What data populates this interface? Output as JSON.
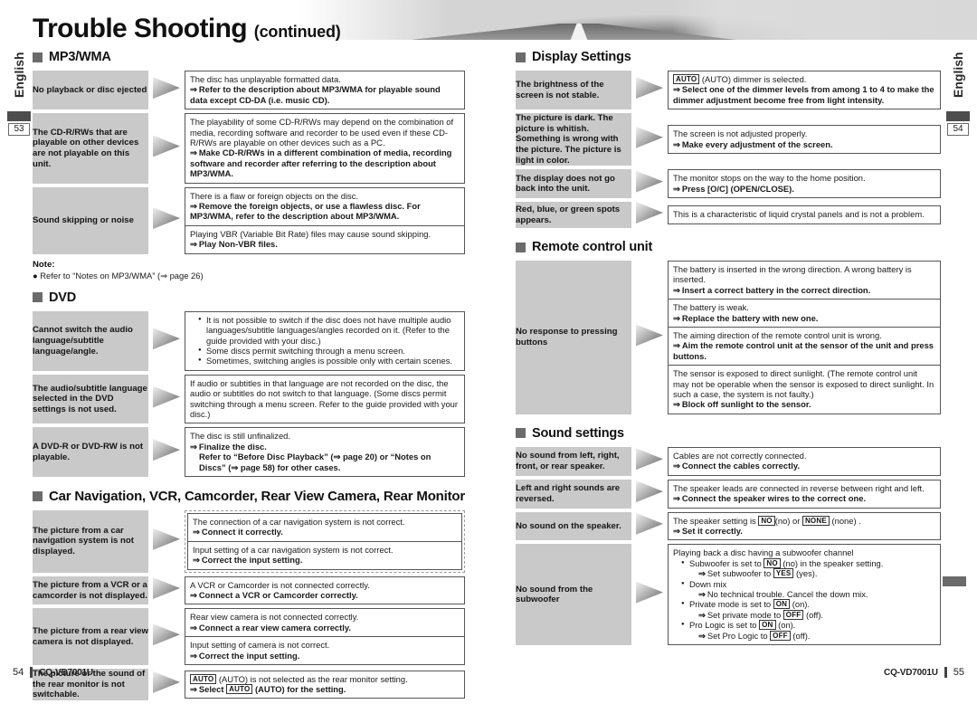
{
  "header": {
    "title": "Trouble Shooting",
    "title_suffix": "(continued)"
  },
  "side_tabs": {
    "left": {
      "language": "English",
      "page": "53"
    },
    "right": {
      "language": "English",
      "page": "54"
    }
  },
  "footer": {
    "left_page": "54",
    "left_model": "CQ-VD7001U",
    "right_model": "CQ-VD7001U",
    "right_page": "55"
  },
  "sections": {
    "mp3wma": {
      "heading": "MP3/WMA",
      "rows": [
        {
          "symptom": "No playback or disc ejected",
          "blocks": [
            {
              "lines": [
                {
                  "text": "The disc has unplayable formatted data.",
                  "bold": false
                },
                {
                  "text": "Refer to the description about MP3/WMA for playable sound data except CD-DA (i.e. music CD).",
                  "bold": true,
                  "arrow": true
                }
              ]
            }
          ]
        },
        {
          "symptom": "The CD-R/RWs that are playable on other devices are not playable on this unit.",
          "blocks": [
            {
              "lines": [
                {
                  "text": "The playability of some CD-R/RWs may depend on the combination of media, recording software and recorder to be used even if these CD-R/RWs are playable on other devices such as a PC.",
                  "bold": false
                },
                {
                  "text": "Make CD-R/RWs in a different combination of media, recording software and recorder after referring to the description about MP3/WMA.",
                  "bold": true,
                  "arrow": true
                }
              ]
            }
          ]
        },
        {
          "symptom": "Sound skipping or noise",
          "blocks": [
            {
              "lines": [
                {
                  "text": "There is a flaw or foreign objects on the disc.",
                  "bold": false
                },
                {
                  "text": "Remove the foreign objects, or use a flawless disc. For MP3/WMA, refer to the description about MP3/WMA.",
                  "bold": true,
                  "arrow": true
                }
              ]
            },
            {
              "lines": [
                {
                  "text": "Playing VBR (Variable Bit Rate) files may cause sound skipping.",
                  "bold": false
                },
                {
                  "text": "Play Non-VBR files.",
                  "bold": true,
                  "arrow": true
                }
              ]
            }
          ]
        }
      ],
      "note_label": "Note:",
      "note_text": "Refer to “Notes on MP3/WMA” (⇒ page 26)"
    },
    "dvd": {
      "heading": "DVD",
      "rows": [
        {
          "symptom": "Cannot switch the audio language/subtitle language/angle.",
          "bullets": [
            "It is not possible to switch if the disc does not have multiple audio languages/subtitle languages/angles recorded on it. (Refer to the guide provided with your disc.)",
            "Some discs permit switching through a menu screen.",
            "Sometimes, switching angles is possible only with certain scenes."
          ]
        },
        {
          "symptom": "The audio/subtitle language selected in the DVD settings is not used.",
          "blocks": [
            {
              "lines": [
                {
                  "text": "If audio or subtitles in that language are not recorded on the disc, the audio or subtitles do not switch to that language. (Some discs permit switching through a menu screen. Refer to the guide provided with your disc.)",
                  "bold": false
                }
              ]
            }
          ]
        },
        {
          "symptom": "A DVD-R or DVD-RW is not playable.",
          "blocks": [
            {
              "lines": [
                {
                  "text": "The disc is still unfinalized.",
                  "bold": false
                },
                {
                  "text": "Finalize the disc.",
                  "bold": true,
                  "arrow": true
                },
                {
                  "text": "Refer to “Before Disc Playback” (⇒ page 20) or “Notes on Discs” (⇒ page 58) for other cases.",
                  "bold": true,
                  "indent": true
                }
              ]
            }
          ]
        }
      ]
    },
    "car_nav": {
      "heading": "Car Navigation, VCR, Camcorder, Rear View Camera, Rear Monitor",
      "rows": [
        {
          "symptom": "The picture from a car navigation system is not displayed.",
          "dashed": true,
          "blocks": [
            {
              "lines": [
                {
                  "text": "The connection of a car navigation system is not correct.",
                  "bold": false
                },
                {
                  "text": "Connect it correctly.",
                  "bold": true,
                  "arrow": true
                }
              ]
            },
            {
              "lines": [
                {
                  "text": "Input setting of a car navigation system is not correct.",
                  "bold": false
                },
                {
                  "text": "Correct the input setting.",
                  "bold": true,
                  "arrow": true
                }
              ]
            }
          ]
        },
        {
          "symptom": "The picture from a VCR or a camcorder is not displayed.",
          "blocks": [
            {
              "lines": [
                {
                  "text": "A VCR or Camcorder is not connected correctly.",
                  "bold": false
                },
                {
                  "text": "Connect a VCR or Camcorder correctly.",
                  "bold": true,
                  "arrow": true
                }
              ]
            }
          ]
        },
        {
          "symptom": "The picture from a rear view camera is not displayed.",
          "blocks": [
            {
              "lines": [
                {
                  "text": "Rear view camera is not connected correctly.",
                  "bold": false
                },
                {
                  "text": "Connect a rear view camera correctly.",
                  "bold": true,
                  "arrow": true
                }
              ]
            },
            {
              "lines": [
                {
                  "text": "Input setting of camera is not correct.",
                  "bold": false
                },
                {
                  "text": "Correct the input setting.",
                  "bold": true,
                  "arrow": true
                }
              ]
            }
          ]
        },
        {
          "symptom": "The picture or the sound of the rear monitor is not switchable.",
          "blocks": [
            {
              "rich": true,
              "line1_kbd": "AUTO",
              "line1_rest": "(AUTO) is not selected as the rear monitor setting.",
              "line2_pre": "Select",
              "line2_kbd": "AUTO",
              "line2_rest": "(AUTO) for the setting."
            }
          ]
        }
      ]
    },
    "display_settings": {
      "heading": "Display Settings",
      "rows": [
        {
          "symptom": "The brightness of the screen is not stable.",
          "blocks": [
            {
              "rich": true,
              "line1_kbd": "AUTO",
              "line1_rest": "(AUTO) dimmer is selected.",
              "line2_bold_full": "Select one of the dimmer levels from among 1 to 4 to make the dimmer adjustment become free from light intensity."
            }
          ]
        },
        {
          "symptom": "The picture is dark. The picture is whitish. Something is wrong with the picture. The picture is light in color.",
          "blocks": [
            {
              "lines": [
                {
                  "text": "The screen is not adjusted properly.",
                  "bold": false
                },
                {
                  "text": "Make every adjustment of the screen.",
                  "bold": true,
                  "arrow": true
                }
              ]
            }
          ]
        },
        {
          "symptom": "The display does not go back into the unit.",
          "blocks": [
            {
              "lines": [
                {
                  "text": "The monitor stops on the way to the home position.",
                  "bold": false
                },
                {
                  "text": "Press [O/C] (OPEN/CLOSE).",
                  "bold": true,
                  "arrow": true
                }
              ]
            }
          ]
        },
        {
          "symptom": "Red, blue, or green spots appears.",
          "blocks": [
            {
              "lines": [
                {
                  "text": "This is a characteristic of liquid crystal panels and is not a problem.",
                  "bold": false
                }
              ]
            }
          ]
        }
      ]
    },
    "remote_control": {
      "heading": "Remote control unit",
      "rows": [
        {
          "symptom": "No response to pressing buttons",
          "blocks": [
            {
              "lines": [
                {
                  "text": "The battery is inserted in the wrong direction. A wrong battery is inserted.",
                  "bold": false
                },
                {
                  "text": "Insert a correct battery in the correct direction.",
                  "bold": true,
                  "arrow": true
                }
              ]
            },
            {
              "lines": [
                {
                  "text": "The battery is weak.",
                  "bold": false
                },
                {
                  "text": "Replace the battery with new one.",
                  "bold": true,
                  "arrow": true
                }
              ]
            },
            {
              "lines": [
                {
                  "text": "The aiming direction of the remote control unit is wrong.",
                  "bold": false
                },
                {
                  "text": "Aim the remote control unit at the sensor of the unit and press buttons.",
                  "bold": true,
                  "arrow": true
                }
              ]
            },
            {
              "lines": [
                {
                  "text": "The sensor is exposed to direct sunlight. (The remote control unit may not be operable when the sensor is exposed to direct sunlight. In such a case, the system is not faulty.)",
                  "bold": false
                },
                {
                  "text": "Block off sunlight to the sensor.",
                  "bold": true,
                  "arrow": true
                }
              ]
            }
          ]
        }
      ]
    },
    "sound_settings": {
      "heading": "Sound settings",
      "rows": [
        {
          "symptom": "No sound from left, right, front, or rear speaker.",
          "blocks": [
            {
              "lines": [
                {
                  "text": "Cables are not correctly connected.",
                  "bold": false
                },
                {
                  "text": "Connect the cables correctly.",
                  "bold": true,
                  "arrow": true
                }
              ]
            }
          ]
        },
        {
          "symptom": "Left and right sounds are reversed.",
          "blocks": [
            {
              "lines": [
                {
                  "text": "The speaker leads are connected in reverse between right and left.",
                  "bold": false
                },
                {
                  "text": "Connect the speaker wires to the correct one.",
                  "bold": true,
                  "arrow": true
                }
              ]
            }
          ]
        },
        {
          "symptom": "No sound on the speaker.",
          "speaker_setting": {
            "pre": "The speaker setting is",
            "kbd1": "NO",
            "mid1": "(no) or",
            "kbd2": "NONE",
            "post": "(none) .",
            "action": "Set it correctly."
          }
        },
        {
          "symptom": "No sound from the subwoofer",
          "subwoofer": {
            "intro": "Playing back a disc having a subwoofer channel",
            "items": [
              {
                "pre": "Subwoofer is set to",
                "kbd": "NO",
                "post": "(no) in the speaker setting.",
                "act_pre": "Set subwoofer to",
                "act_kbd": "YES",
                "act_post": "(yes)."
              },
              {
                "pre": "Down mix",
                "kbd": "",
                "post": "",
                "act_pre": "No technical trouble. Cancel the down mix.",
                "act_kbd": "",
                "act_post": ""
              },
              {
                "pre": "Private mode is set to",
                "kbd": "ON",
                "post": "(on).",
                "act_pre": "Set private mode to",
                "act_kbd": "OFF",
                "act_post": "(off)."
              },
              {
                "pre": "Pro Logic is set to",
                "kbd": "ON",
                "post": "(on).",
                "act_pre": "Set Pro Logic to",
                "act_kbd": "OFF",
                "act_post": "(off)."
              }
            ]
          }
        }
      ]
    }
  }
}
